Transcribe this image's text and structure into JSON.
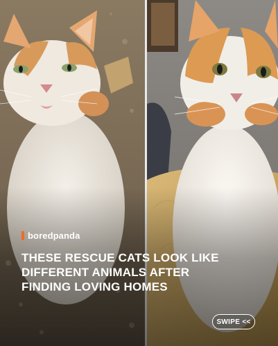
{
  "brand": {
    "name": "boredpanda",
    "accent_color": "#f26b21"
  },
  "headline": {
    "lines": [
      "THESE RESCUE CATS LOOK LIKE",
      "DIFFERENT ANIMALS AFTER",
      "FINDING LOVING HOMES"
    ]
  },
  "swipe_button": {
    "label": "SWIPE <<"
  },
  "photos": {
    "before": {
      "subject": "scruffy orange and white stray cat on dirt ground",
      "icon": "cat-photo-before"
    },
    "after": {
      "subject": "healthy orange and white cat indoors",
      "icon": "cat-photo-after"
    }
  }
}
